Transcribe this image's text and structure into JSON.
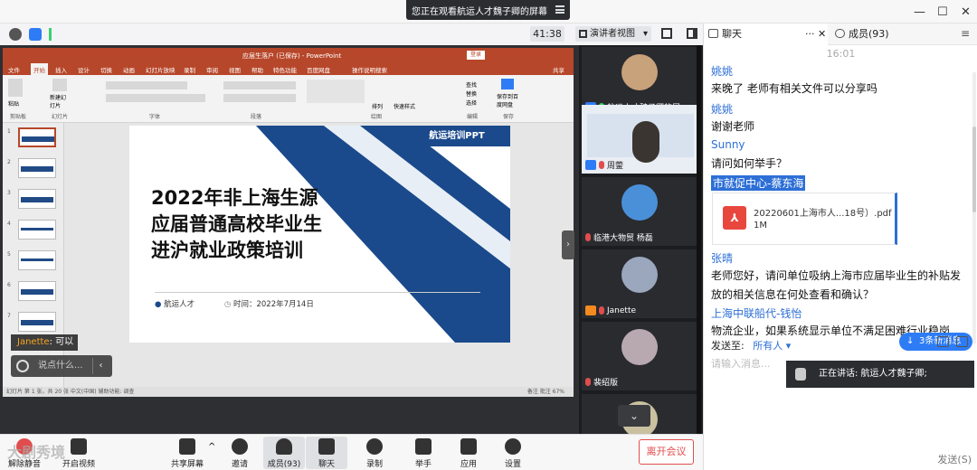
{
  "window": {
    "share_banner": "您正在观看航运人才魏子卿的屏幕",
    "controls": [
      "—",
      "☐",
      "✕"
    ]
  },
  "meeting_bar": {
    "timer": "41:38",
    "view_mode": "演讲者视图",
    "status_colors": {
      "info": "#555555",
      "shield": "#2d7cf6",
      "signal": "#3bd16f"
    }
  },
  "ppt": {
    "doc_title": "应届生落户 (已保存) - PowerPoint",
    "login": "登录",
    "tabs": [
      "文件",
      "开始",
      "插入",
      "设计",
      "切换",
      "动画",
      "幻灯片放映",
      "录制",
      "审阅",
      "视图",
      "帮助",
      "特色功能",
      "百度网盘",
      "操作说明搜索",
      "共享"
    ],
    "ribbon_groups": [
      "剪贴板",
      "幻灯片",
      "字体",
      "段落",
      "绘图",
      "编辑",
      "保存"
    ],
    "ribbon_buttons": {
      "paste": "粘贴",
      "new_slide": "新建幻灯片",
      "arrange": "排列",
      "quick_styles": "快速样式",
      "find": "查找",
      "replace": "替换",
      "select": "选择",
      "save_baidu": "保存到百度网盘"
    },
    "thumb_numbers": [
      "1",
      "2",
      "3",
      "4",
      "5",
      "6",
      "7"
    ],
    "slide": {
      "tag": "航运培训PPT",
      "title_lines": [
        "2022年非上海生源",
        "应届普通高校毕业生",
        "进沪就业政策培训"
      ],
      "footer_author": "航运人才",
      "footer_time": "时间：2022年7月14日",
      "accent": "#1a4a8b"
    },
    "status": "幻灯片 第 1 张，共 20 张    中文(中国)    辅助功能: 调查",
    "status_right": "备注    批注    67%"
  },
  "overlays": {
    "chat_float_name": "Janette",
    "chat_float_text": ": 可以",
    "say_placeholder": "说点什么...",
    "say_arrow": "‹",
    "collapse": "›"
  },
  "participants": [
    {
      "name": "航运人才魏子卿的屏...",
      "mic": "on",
      "avatar_color": "#c8a27a"
    },
    {
      "name": "周蓥",
      "mic": "off",
      "avatar_color": "#d9d9d9"
    },
    {
      "name": "临港大物贸 杨磊",
      "mic": "off",
      "avatar_color": "#4a90d9"
    },
    {
      "name": "Janette",
      "mic": "off",
      "avatar_color": "#9aa7bd"
    },
    {
      "name": "裴绍版",
      "mic": "off",
      "avatar_color": "#b8a9b0"
    },
    {
      "name": "",
      "mic": "off",
      "avatar_color": "#c9c0a0"
    }
  ],
  "strip_down": "⌄",
  "toolbar": {
    "mute": "解除静音",
    "video": "开启视频",
    "share": "共享屏幕",
    "invite": "邀请",
    "members": "成员(93)",
    "chat": "聊天",
    "record": "录制",
    "raise_hand": "举手",
    "apps": "应用",
    "settings": "设置",
    "leave": "离开会议",
    "watermark": "大剧秀境"
  },
  "panel": {
    "tab_chat": "聊天",
    "tab_chat_more": "···",
    "tab_close": "✕",
    "tab_members": "成员(93)",
    "tab_menu": "≡",
    "time": "16:01",
    "messages": [
      {
        "name": "姚姚",
        "text": "来晚了 老师有相关文件可以分享吗"
      },
      {
        "name": "姚姚",
        "text": "谢谢老师"
      },
      {
        "name": "Sunny",
        "text": "请问如何举手？"
      },
      {
        "name": "市就促中心-蔡东海",
        "text": ""
      },
      {
        "name": "张晴",
        "text": "老师您好，请问单位吸纳上海市应届毕业生的补贴发放的相关信息在何处查看和确认？"
      },
      {
        "name": "上海中联船代-钱怡",
        "text": "物流企业，如果系统显示单位不满足困难行业稳岗..."
      }
    ],
    "file": {
      "icon": "pdf-icon",
      "name": "20220601上海市人...18号）.pdf",
      "size": "1M"
    },
    "new_messages": "3条新消息",
    "send_to_label": "发送至:",
    "send_to_value": "所有人 ▾",
    "input_placeholder": "请输入消息...",
    "speaking": "正在讲话: 航运人才魏子卿;",
    "send_button": "发送(S)"
  }
}
